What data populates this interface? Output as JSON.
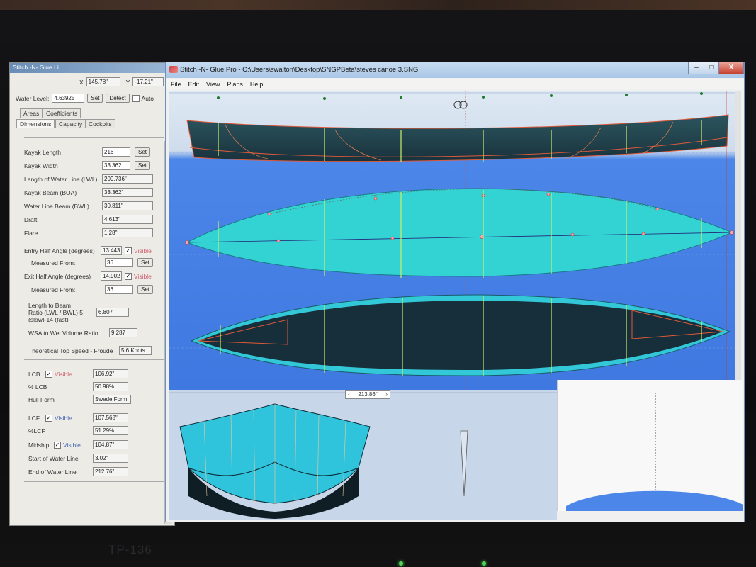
{
  "side_panel": {
    "title": "Stitch -N- Glue Li",
    "coord_x_label": "X",
    "coord_x": "145.78\"",
    "coord_y_label": "Y",
    "coord_y": "-17.21\"",
    "water_level_label": "Water Level:",
    "water_level": "4.63925",
    "set_label": "Set",
    "detect_label": "Detect",
    "auto_label": "Auto",
    "tabs_row1": [
      "Areas",
      "Coefficients"
    ],
    "tabs_row2": [
      "Dimensions",
      "Capacity",
      "Cockpits"
    ],
    "kayak_length_label": "Kayak Length",
    "kayak_length": "216",
    "kayak_width_label": "Kayak Width",
    "kayak_width": "33.362",
    "lwl_label": "Length of Water Line (LWL)",
    "lwl": "209.736\"",
    "boa_label": "Kayak Beam (BOA)",
    "boa": "33.362\"",
    "bwl_label": "Water Line Beam (BWL)",
    "bwl": "30.811\"",
    "draft_label": "Draft",
    "draft": "4.613\"",
    "flare_label": "Flare",
    "flare": "1.28\"",
    "entry_label": "Entry Half Angle (degrees)",
    "entry": "13.443",
    "visible_label": "Visible",
    "measured_from_label": "Measured From:",
    "entry_measured": "36",
    "exit_label": "Exit Half Angle (degrees)",
    "exit": "14.902",
    "exit_measured": "36",
    "ratio_label_1": "Length to Beam",
    "ratio_label_2": "Ratio (LWL / BWL) 5",
    "ratio_label_3": "(slow)-14 (fast)",
    "ratio": "6.807",
    "wsa_label": "WSA to Wet Volume Ratio",
    "wsa": "9.287",
    "speed_label": "Theoretical Top Speed - Froude",
    "speed": "5.6 Knots",
    "lcb_label": "LCB",
    "lcb": "106.92\"",
    "pct_lcb_label": "% LCB",
    "pct_lcb": "50.98%",
    "hull_form_label": "Hull Form",
    "hull_form": "Swede Form",
    "lcf_label": "LCF",
    "lcf": "107.568\"",
    "pct_lcf_label": "%LCF",
    "pct_lcf": "51.29%",
    "midship_label": "Midship",
    "midship": "104.87\"",
    "start_wl_label": "Start of Water Line",
    "start_wl": "3.02\"",
    "end_wl_label": "End of Water Line",
    "end_wl": "212.76\""
  },
  "main_window": {
    "title": "Stitch -N- Glue Pro - C:\\Users\\swalton\\Desktop\\SNGPBeta\\steves canoe 3.SNG",
    "menu": [
      "File",
      "Edit",
      "View",
      "Plans",
      "Help"
    ],
    "position_readout": "213.86\"",
    "min_icon": "–",
    "max_icon": "□",
    "close_icon": "X"
  },
  "bezel_label": "TP-136",
  "colors": {
    "hull_dark": "#1f3d47",
    "hull_cyan": "#33d3d3",
    "station_line": "#c8f06a",
    "water_blue": "#4c86e8",
    "chine_red": "#e05a3a"
  }
}
